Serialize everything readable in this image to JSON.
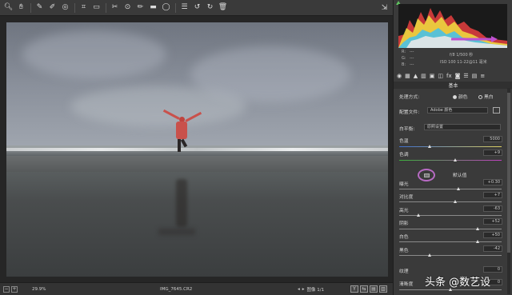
{
  "toolbar": {
    "icons": [
      "zoom-icon",
      "hand-icon",
      "eyedropper-icon",
      "color-sampler-icon",
      "target-adjust-icon",
      "crop-icon",
      "straighten-icon",
      "spot-removal-icon",
      "red-eye-icon",
      "adjustment-brush-icon",
      "graduated-filter-icon",
      "radial-filter-icon",
      "preferences-icon",
      "rotate-left-icon",
      "rotate-right-icon",
      "trash-icon"
    ],
    "right_icon": "export-icon"
  },
  "statusbar": {
    "zoom": "29.9%",
    "filename": "IMG_7645.CR2",
    "nav_label": "图像 1/1",
    "tools": [
      "Y",
      "⇆",
      "▤",
      "▥"
    ]
  },
  "panel": {
    "exif": {
      "r_label": "R:",
      "g_label": "G:",
      "b_label": "B:",
      "r_val": "---",
      "g_val": "---",
      "b_val": "---",
      "line1": "f/8   1/500 秒",
      "line2": "ISO 100   11-22@11 毫米"
    },
    "section_title": "基本",
    "treatment_label": "处理方式:",
    "treatment_color": "颜色",
    "treatment_bw": "黑白",
    "profile_label": "配置文件:",
    "profile_value": "Adobe 颜色",
    "wb_label": "白平衡:",
    "wb_value": "原照设置",
    "temp_label": "色温",
    "temp_value": "5000",
    "tint_label": "色调",
    "tint_value": "+9",
    "auto_label": "默认值",
    "exposure_label": "曝光",
    "exposure_value": "+0.30",
    "contrast_label": "对比度",
    "contrast_value": "+7",
    "highlights_label": "高光",
    "highlights_value": "-63",
    "shadows_label": "阴影",
    "shadows_value": "+52",
    "whites_label": "白色",
    "whites_value": "+50",
    "blacks_label": "黑色",
    "blacks_value": "-42",
    "texture_label": "纹理",
    "texture_value": "0",
    "clarity_label": "清晰度",
    "clarity_value": "0"
  },
  "watermark": "头条 @数艺设",
  "colors": {
    "panel": "#3a3a3a",
    "accent_circle": "#b86bc4"
  }
}
